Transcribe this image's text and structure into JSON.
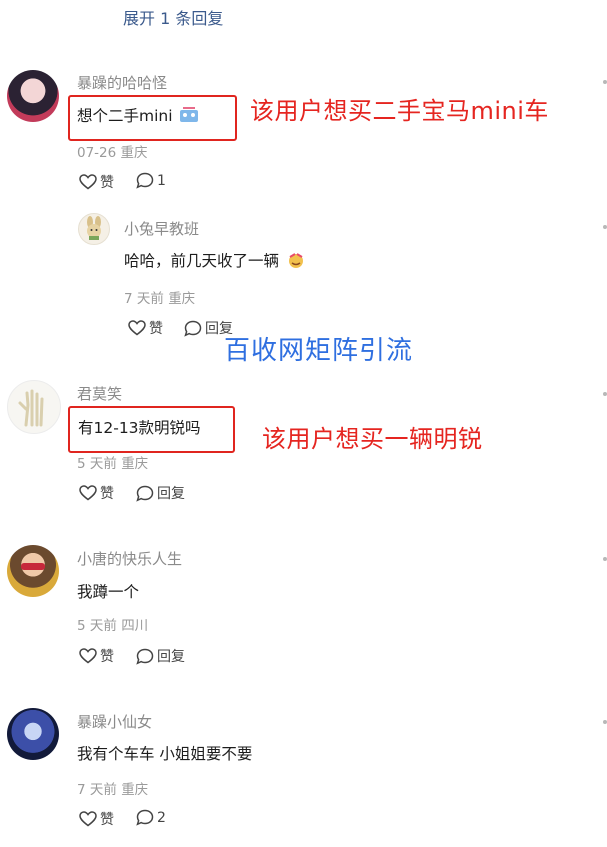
{
  "expand_link": "展开 1 条回复",
  "comments": [
    {
      "username": "暴躁的哈哈怪",
      "text": "想个二手mini",
      "date": "07-26",
      "location": "重庆",
      "like_label": "赞",
      "reply_count": "1",
      "annotation": "该用户想买二手宝马mini车",
      "reply": {
        "username": "小兔早教班",
        "text": "哈哈，前几天收了一辆",
        "date": "7 天前",
        "location": "重庆",
        "like_label": "赞",
        "reply_label": "回复"
      }
    },
    {
      "username": "君莫笑",
      "text": "有12-13款明锐吗",
      "date": "5 天前",
      "location": "重庆",
      "like_label": "赞",
      "reply_label": "回复",
      "annotation": "该用户想买一辆明锐"
    },
    {
      "username": "小唐的快乐人生",
      "text": "我蹲一个",
      "date": "5 天前",
      "location": "四川",
      "like_label": "赞",
      "reply_label": "回复"
    },
    {
      "username": "暴躁小仙女",
      "text": "我有个车车 小姐姐要不要",
      "date": "7 天前",
      "location": "重庆",
      "like_label": "赞",
      "reply_count": "2"
    }
  ],
  "watermark": "百收网矩阵引流",
  "colors": {
    "annotation_red": "#e52520",
    "watermark_blue": "#2f6fe0",
    "link_blue": "#3b5a8c"
  },
  "icons": [
    "heart-icon",
    "comment-icon",
    "more-dots-icon",
    "emoji-icon"
  ]
}
